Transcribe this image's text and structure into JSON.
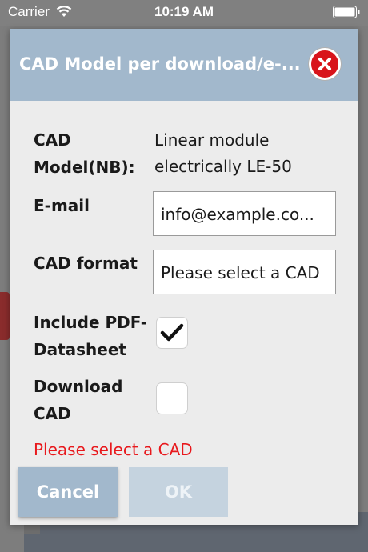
{
  "status_bar": {
    "carrier": "Carrier",
    "time": "10:19 AM",
    "wifi_icon": "wifi-icon",
    "battery_icon": "battery-icon"
  },
  "dialog": {
    "title": "CAD Model per download/e-...",
    "close_icon": "close-icon",
    "accent_color": "#a2b8cc",
    "close_color": "#d8141b",
    "fields": {
      "model_label_line1": "CAD",
      "model_label_line2": "Model(NB):",
      "model_value_line1": "Linear module",
      "model_value_line2": "electrically LE-50",
      "email_label": "E-mail",
      "email_value": "info@example.co...",
      "format_label": "CAD format",
      "format_value": "Please select a CAD",
      "pdf_label_line1": "Include PDF-",
      "pdf_label_line2": "Datasheet",
      "pdf_checked": true,
      "download_label_line1": "Download",
      "download_label_line2": "CAD",
      "download_checked": false
    },
    "validation_message": "Please select a CAD",
    "validation_color": "#e8181c",
    "buttons": {
      "cancel": "Cancel",
      "ok": "OK"
    }
  }
}
